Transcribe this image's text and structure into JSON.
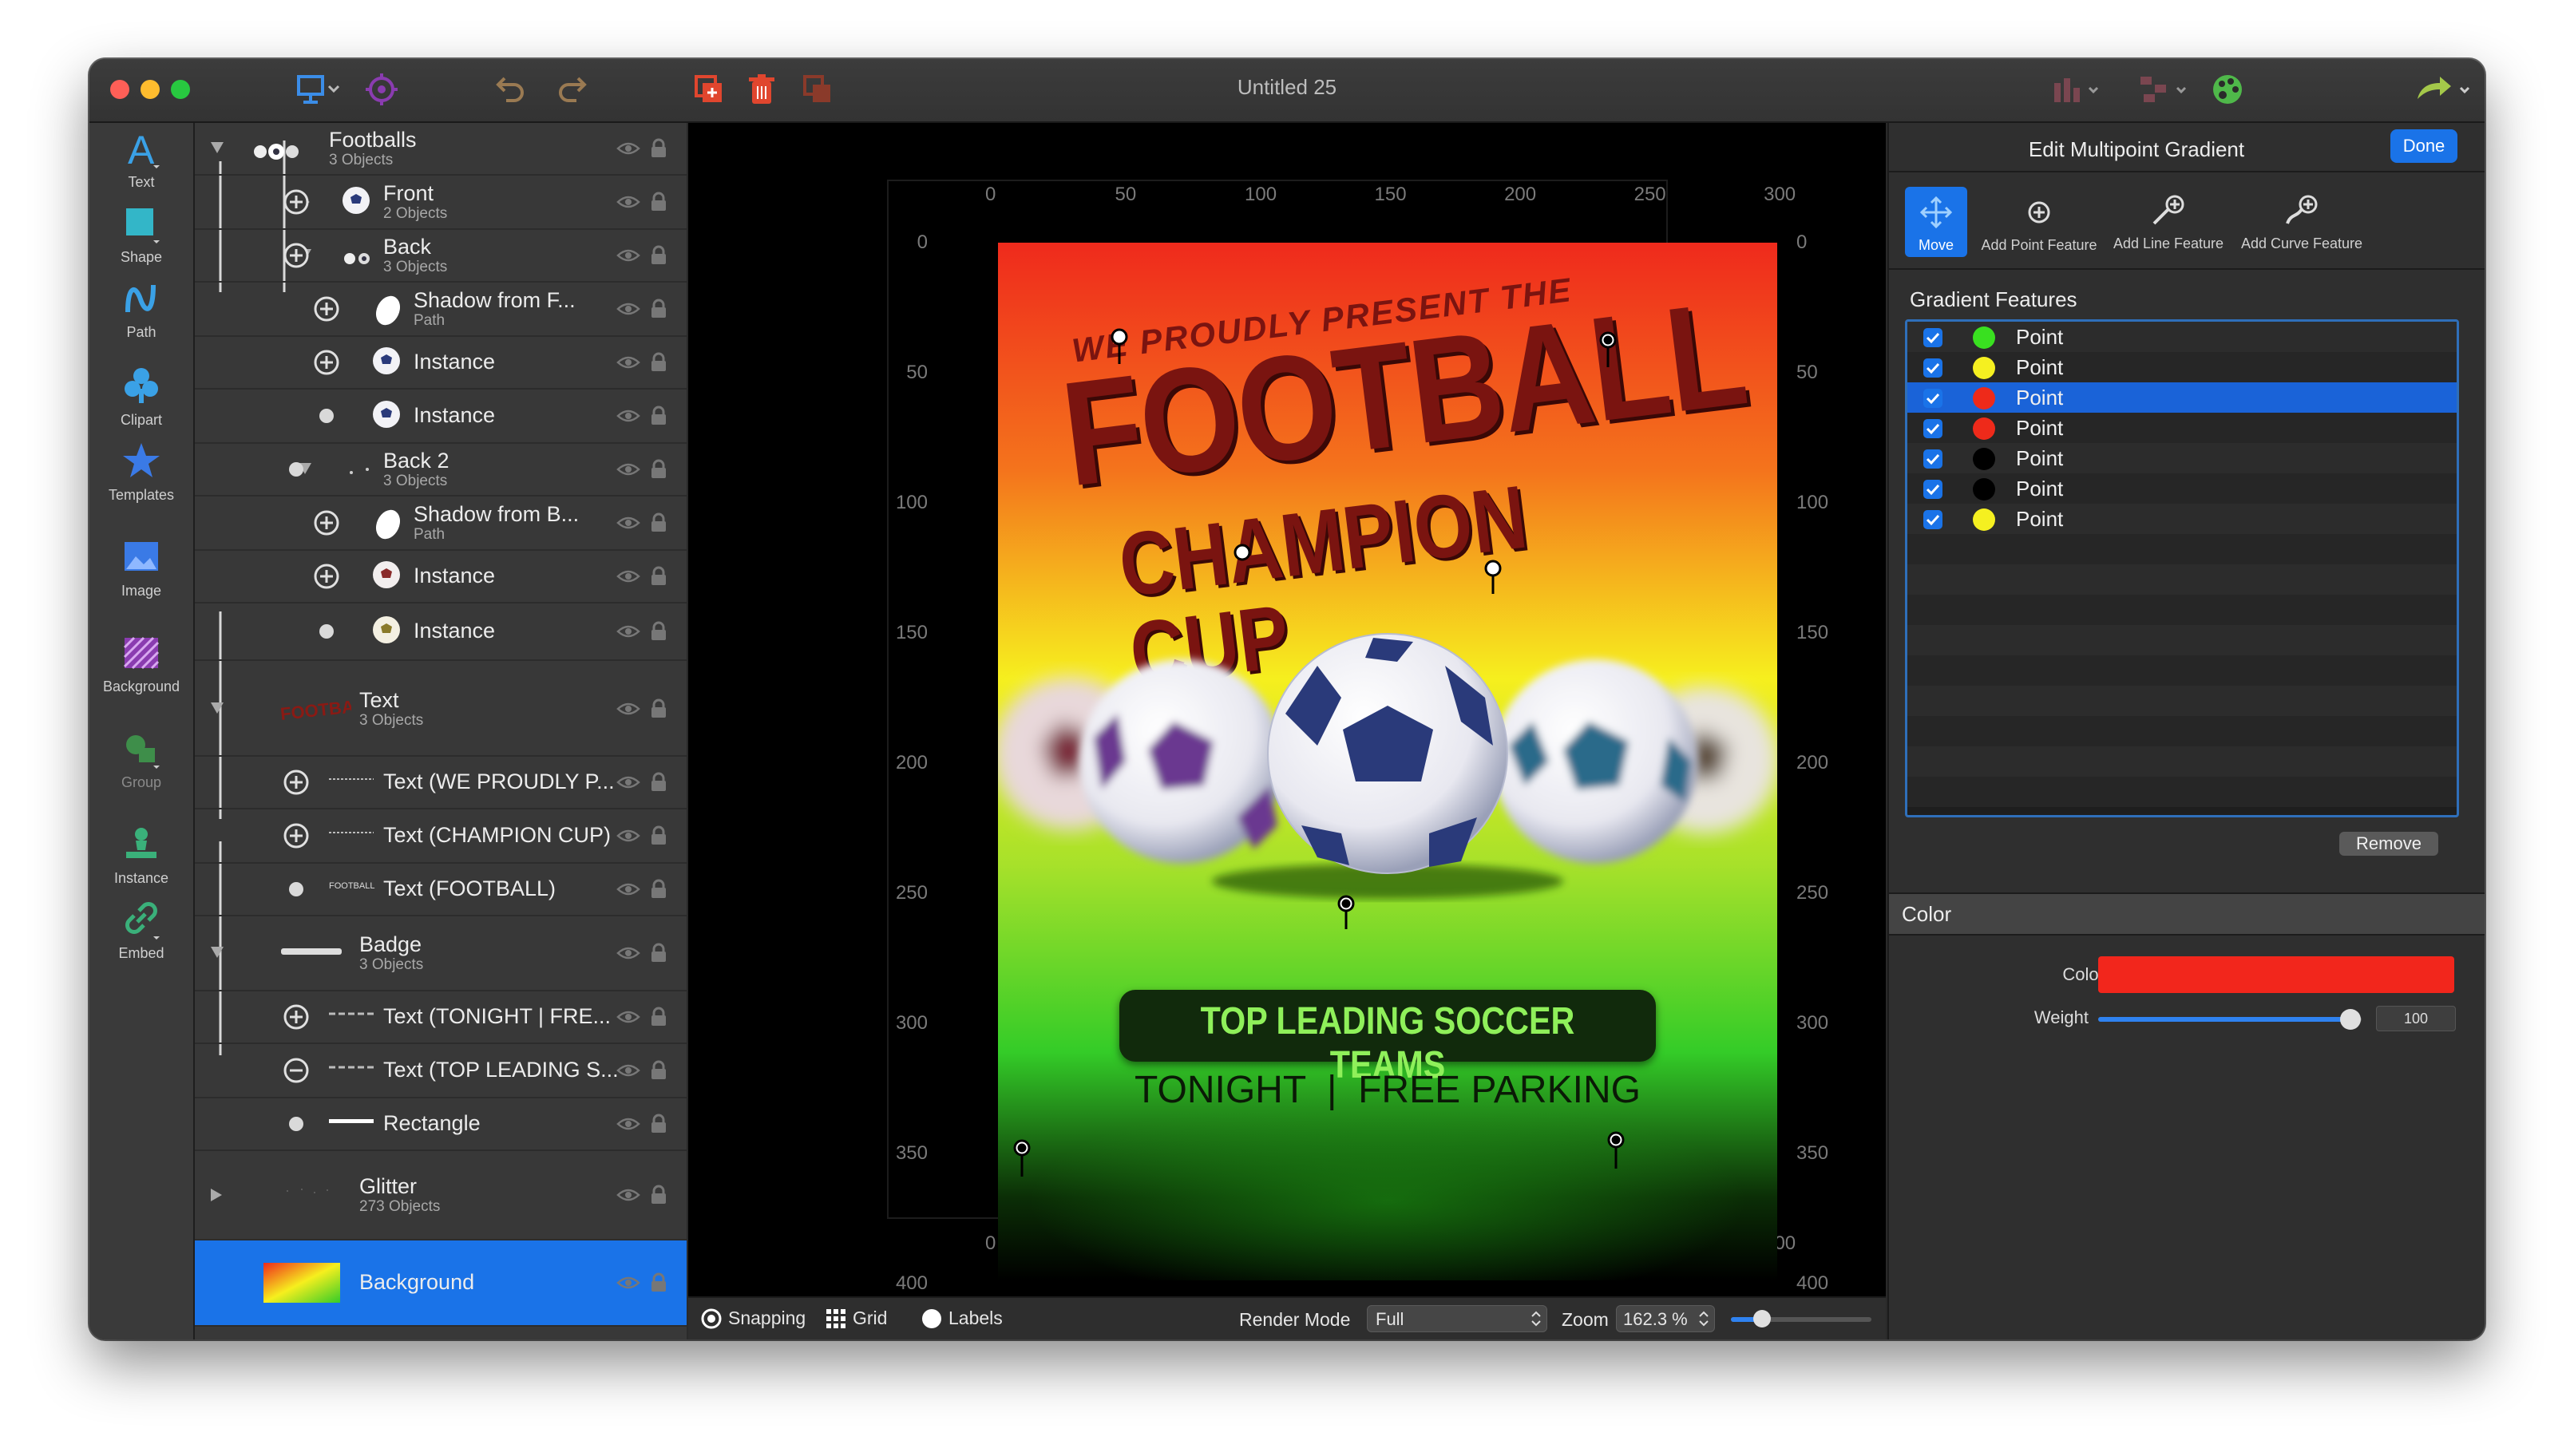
{
  "window": {
    "title": "Untitled 25"
  },
  "tools": [
    {
      "label": "Text",
      "icon": "text-icon"
    },
    {
      "label": "Shape",
      "icon": "shape-icon"
    },
    {
      "label": "Path",
      "icon": "path-icon"
    },
    {
      "label": "Clipart",
      "icon": "clipart-icon"
    },
    {
      "label": "Templates",
      "icon": "templates-icon"
    },
    {
      "label": "Image",
      "icon": "image-icon"
    },
    {
      "label": "Background",
      "icon": "background-icon"
    },
    {
      "label": "Group",
      "icon": "group-icon"
    },
    {
      "label": "Instance",
      "icon": "instance-icon"
    },
    {
      "label": "Embed",
      "icon": "embed-icon"
    }
  ],
  "layers": [
    {
      "name": "Footballs",
      "sub": "3 Objects"
    },
    {
      "name": "Front",
      "sub": "2 Objects"
    },
    {
      "name": "Back",
      "sub": "3 Objects"
    },
    {
      "name": "Shadow from F...",
      "sub": "Path"
    },
    {
      "name": "Instance",
      "sub": ""
    },
    {
      "name": "Instance",
      "sub": ""
    },
    {
      "name": "Back 2",
      "sub": "3 Objects"
    },
    {
      "name": "Shadow from B...",
      "sub": "Path"
    },
    {
      "name": "Instance",
      "sub": ""
    },
    {
      "name": "Instance",
      "sub": ""
    },
    {
      "name": "Text",
      "sub": "3 Objects"
    },
    {
      "name": "Text (WE PROUDLY P...",
      "sub": ""
    },
    {
      "name": "Text (CHAMPION CUP)",
      "sub": ""
    },
    {
      "name": "Text (FOOTBALL)",
      "sub": ""
    },
    {
      "name": "Badge",
      "sub": "3 Objects"
    },
    {
      "name": "Text (TONIGHT  |  FRE...",
      "sub": ""
    },
    {
      "name": "Text (TOP LEADING S...",
      "sub": ""
    },
    {
      "name": "Rectangle",
      "sub": ""
    },
    {
      "name": "Glitter",
      "sub": "273 Objects"
    },
    {
      "name": "Background",
      "sub": ""
    }
  ],
  "poster": {
    "line1": "WE PROUDLY PRESENT THE",
    "line2": "FOOTBALL",
    "line3": "CHAMPION CUP",
    "badge": "TOP LEADING SOCCER TEAMS",
    "tagline": "TONIGHT  |  FREE PARKING"
  },
  "ruler": {
    "ticks": [
      "0",
      "50",
      "100",
      "150",
      "200",
      "250",
      "300"
    ],
    "vticks": [
      "0",
      "50",
      "100",
      "150",
      "200",
      "250",
      "300",
      "350",
      "400"
    ]
  },
  "bottombar": {
    "snapping": "Snapping",
    "grid": "Grid",
    "labels": "Labels",
    "render_mode_label": "Render Mode",
    "render_mode_value": "Full",
    "zoom_label": "Zoom",
    "zoom_value": "162.3 %",
    "zoom_slider_level": 0.22
  },
  "inspector": {
    "title": "Edit Multipoint Gradient",
    "done": "Done",
    "features_tools": [
      {
        "label": "Move",
        "icon": "move-icon"
      },
      {
        "label": "Add Point Feature",
        "icon": "add-point-icon"
      },
      {
        "label": "Add Line Feature",
        "icon": "add-line-icon"
      },
      {
        "label": "Add Curve Feature",
        "icon": "add-curve-icon"
      }
    ],
    "features_heading": "Gradient Features",
    "features": [
      {
        "label": "Point",
        "color": "#39e020"
      },
      {
        "label": "Point",
        "color": "#f5f020"
      },
      {
        "label": "Point",
        "color": "#ee2a1a"
      },
      {
        "label": "Point",
        "color": "#ee2a1a"
      },
      {
        "label": "Point",
        "color": "#000000"
      },
      {
        "label": "Point",
        "color": "#000000"
      },
      {
        "label": "Point",
        "color": "#f5f020"
      }
    ],
    "selected_feature_index": 2,
    "remove": "Remove",
    "color_section": "Color",
    "color_label": "Color",
    "color_value": "#f2261c",
    "weight_label": "Weight",
    "weight_value": "100",
    "weight_level": 1.0
  }
}
